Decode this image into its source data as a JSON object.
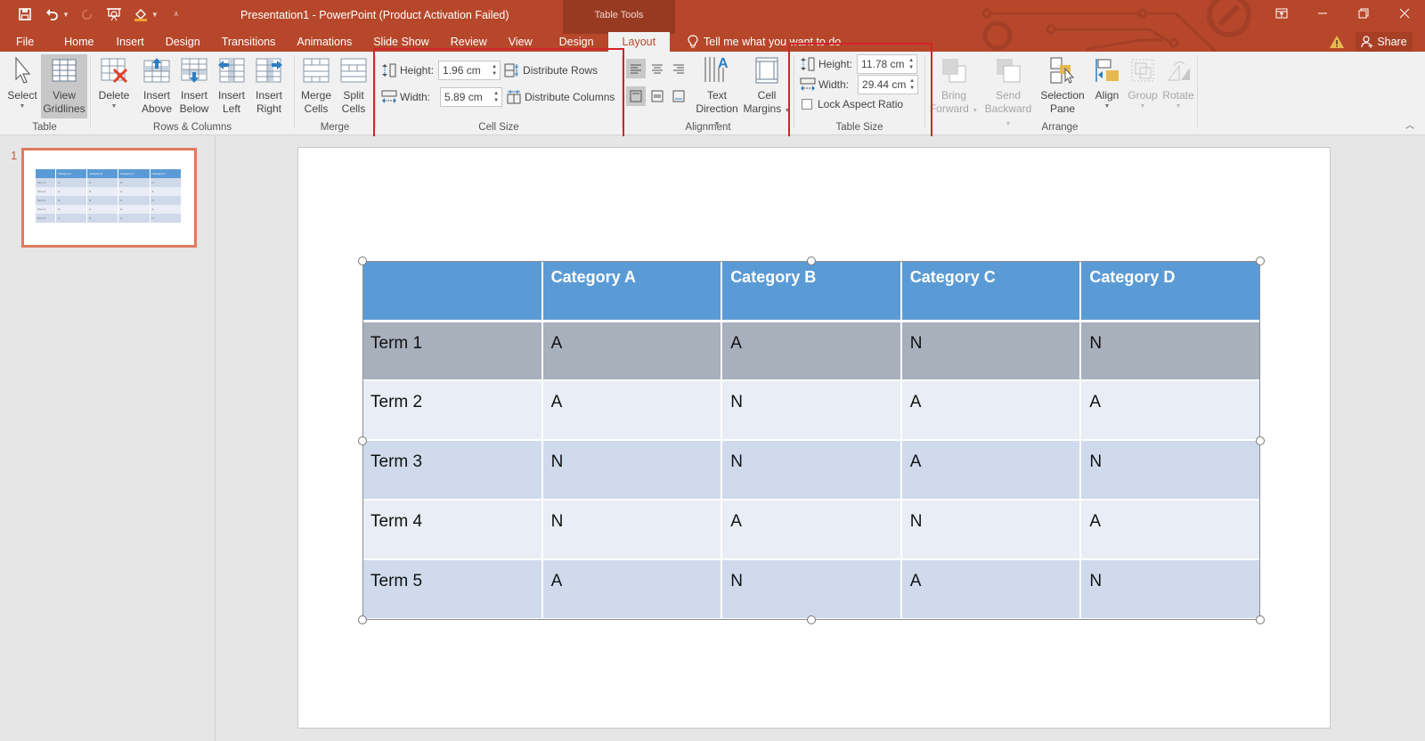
{
  "window": {
    "title": "Presentation1 - PowerPoint (Product Activation Failed)",
    "contextual_tab_group": "Table Tools",
    "accent_color": "#b7472a"
  },
  "quick_access": [
    {
      "name": "save",
      "icon": "save-icon"
    },
    {
      "name": "undo",
      "icon": "undo-icon"
    },
    {
      "name": "redo",
      "icon": "redo-icon"
    },
    {
      "name": "present",
      "icon": "present-from-beginning-icon"
    },
    {
      "name": "format-painter",
      "icon": "paint-bucket-icon"
    },
    {
      "name": "customize",
      "icon": "customize-qat-icon"
    }
  ],
  "tabs": [
    {
      "label": "File"
    },
    {
      "label": "Home"
    },
    {
      "label": "Insert"
    },
    {
      "label": "Design"
    },
    {
      "label": "Transitions"
    },
    {
      "label": "Animations"
    },
    {
      "label": "Slide Show"
    },
    {
      "label": "Review"
    },
    {
      "label": "View"
    },
    {
      "label": "Design"
    },
    {
      "label": "Layout",
      "active": true
    }
  ],
  "tell_me": "Tell me what you want to do",
  "share_label": "Share",
  "ribbon": {
    "table": {
      "label": "Table",
      "select": "Select",
      "view_gridlines_1": "View",
      "view_gridlines_2": "Gridlines"
    },
    "rows_columns": {
      "label": "Rows & Columns",
      "delete": "Delete",
      "insert_above_1": "Insert",
      "insert_above_2": "Above",
      "insert_below_1": "Insert",
      "insert_below_2": "Below",
      "insert_left_1": "Insert",
      "insert_left_2": "Left",
      "insert_right_1": "Insert",
      "insert_right_2": "Right"
    },
    "merge": {
      "label": "Merge",
      "merge_1": "Merge",
      "merge_2": "Cells",
      "split_1": "Split",
      "split_2": "Cells"
    },
    "cell_size": {
      "label": "Cell Size",
      "height_label": "Height:",
      "height_value": "1.96 cm",
      "width_label": "Width:",
      "width_value": "5.89 cm",
      "distribute_rows": "Distribute Rows",
      "distribute_columns": "Distribute Columns"
    },
    "alignment": {
      "label": "Alignment",
      "text_direction_1": "Text",
      "text_direction_2": "Direction",
      "cell_margins_1": "Cell",
      "cell_margins_2": "Margins"
    },
    "table_size": {
      "label": "Table Size",
      "height_label": "Height:",
      "height_value": "11.78 cm",
      "width_label": "Width:",
      "width_value": "29.44 cm",
      "lock_aspect": "Lock Aspect Ratio",
      "lock_aspect_checked": false
    },
    "arrange": {
      "label": "Arrange",
      "bring_forward_1": "Bring",
      "bring_forward_2": "Forward",
      "send_backward_1": "Send",
      "send_backward_2": "Backward",
      "selection_pane_1": "Selection",
      "selection_pane_2": "Pane",
      "align": "Align",
      "group": "Group",
      "rotate": "Rotate"
    }
  },
  "thumbnails": [
    {
      "number": "1",
      "selected": true
    }
  ],
  "table": {
    "headers": [
      "",
      "Category A",
      "Category B",
      "Category C",
      "Category D"
    ],
    "rows": [
      [
        "Term 1",
        "A",
        "A",
        "N",
        "N"
      ],
      [
        "Term 2",
        "A",
        "N",
        "A",
        "A"
      ],
      [
        "Term 3",
        "N",
        "N",
        "A",
        "N"
      ],
      [
        "Term 4",
        "N",
        "A",
        "N",
        "A"
      ],
      [
        "Term 5",
        "A",
        "N",
        "A",
        "N"
      ]
    ],
    "header_color": "#5b9bd5",
    "selected_row_color": "#a8b0bc",
    "band_color_1": "#cfdbec",
    "band_color_2": "#e9edf5"
  }
}
